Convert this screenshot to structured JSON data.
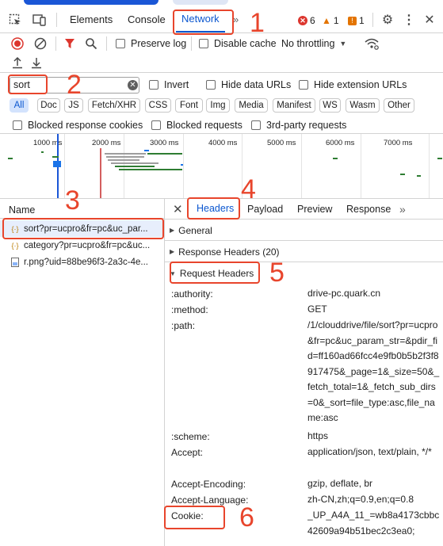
{
  "devtools": {
    "tabs": [
      {
        "label": "Elements"
      },
      {
        "label": "Console"
      },
      {
        "label": "Network"
      }
    ],
    "more_tabs": "»",
    "errors": "6",
    "warnings": "1",
    "issues": "1"
  },
  "toolbar": {
    "preserve_log": "Preserve log",
    "disable_cache": "Disable cache",
    "throttling": "No throttling"
  },
  "filter": {
    "value": "sort",
    "invert": "Invert",
    "hide_data_urls": "Hide data URLs",
    "hide_extension_urls": "Hide extension URLs"
  },
  "types": [
    "All",
    "Doc",
    "JS",
    "Fetch/XHR",
    "CSS",
    "Font",
    "Img",
    "Media",
    "Manifest",
    "WS",
    "Wasm",
    "Other"
  ],
  "blocked": {
    "blocked_cookies": "Blocked response cookies",
    "blocked_requests": "Blocked requests",
    "third_party": "3rd-party requests"
  },
  "timeline": {
    "ticks": [
      "1000 ms",
      "2000 ms",
      "3000 ms",
      "4000 ms",
      "5000 ms",
      "6000 ms",
      "7000 ms"
    ]
  },
  "requests": {
    "header": "Name",
    "items": [
      {
        "name": "sort?pr=ucpro&fr=pc&uc_par..."
      },
      {
        "name": "category?pr=ucpro&fr=pc&uc..."
      },
      {
        "name": "r.png?uid=88be96f3-2a3c-4e..."
      }
    ]
  },
  "detail_tabs": [
    "Headers",
    "Payload",
    "Preview",
    "Response"
  ],
  "sections": {
    "general": "General",
    "response_headers": "Response Headers (20)",
    "request_headers": "Request Headers"
  },
  "request_headers": [
    {
      "key": ":authority:",
      "value": "drive-pc.quark.cn"
    },
    {
      "key": ":method:",
      "value": "GET"
    },
    {
      "key": ":path:",
      "value": "/1/clouddrive/file/sort?pr=ucpro&fr=pc&uc_param_str=&pdir_fid=ff160ad66fcc4e9fb0b5b2f3f8917475&_page=1&_size=50&_fetch_total=1&_fetch_sub_dirs=0&_sort=file_type:asc,file_name:asc"
    },
    {
      "key": ":scheme:",
      "value": "https"
    },
    {
      "key": "Accept:",
      "value": "application/json, text/plain, */*"
    },
    {
      "key": "Accept-Encoding:",
      "value": "gzip, deflate, br"
    },
    {
      "key": "Accept-Language:",
      "value": "zh-CN,zh;q=0.9,en;q=0.8"
    },
    {
      "key": "Cookie:",
      "value": "_UP_A4A_11_=wb8a4173cbbc42609a94b51bec2c3ea0;"
    }
  ],
  "annotations": [
    "1",
    "2",
    "3",
    "4",
    "5",
    "6"
  ],
  "colors": {
    "accent": "#0b57d0",
    "annotation": "#e8452c",
    "error": "#dc362e",
    "warning": "#e37400"
  }
}
